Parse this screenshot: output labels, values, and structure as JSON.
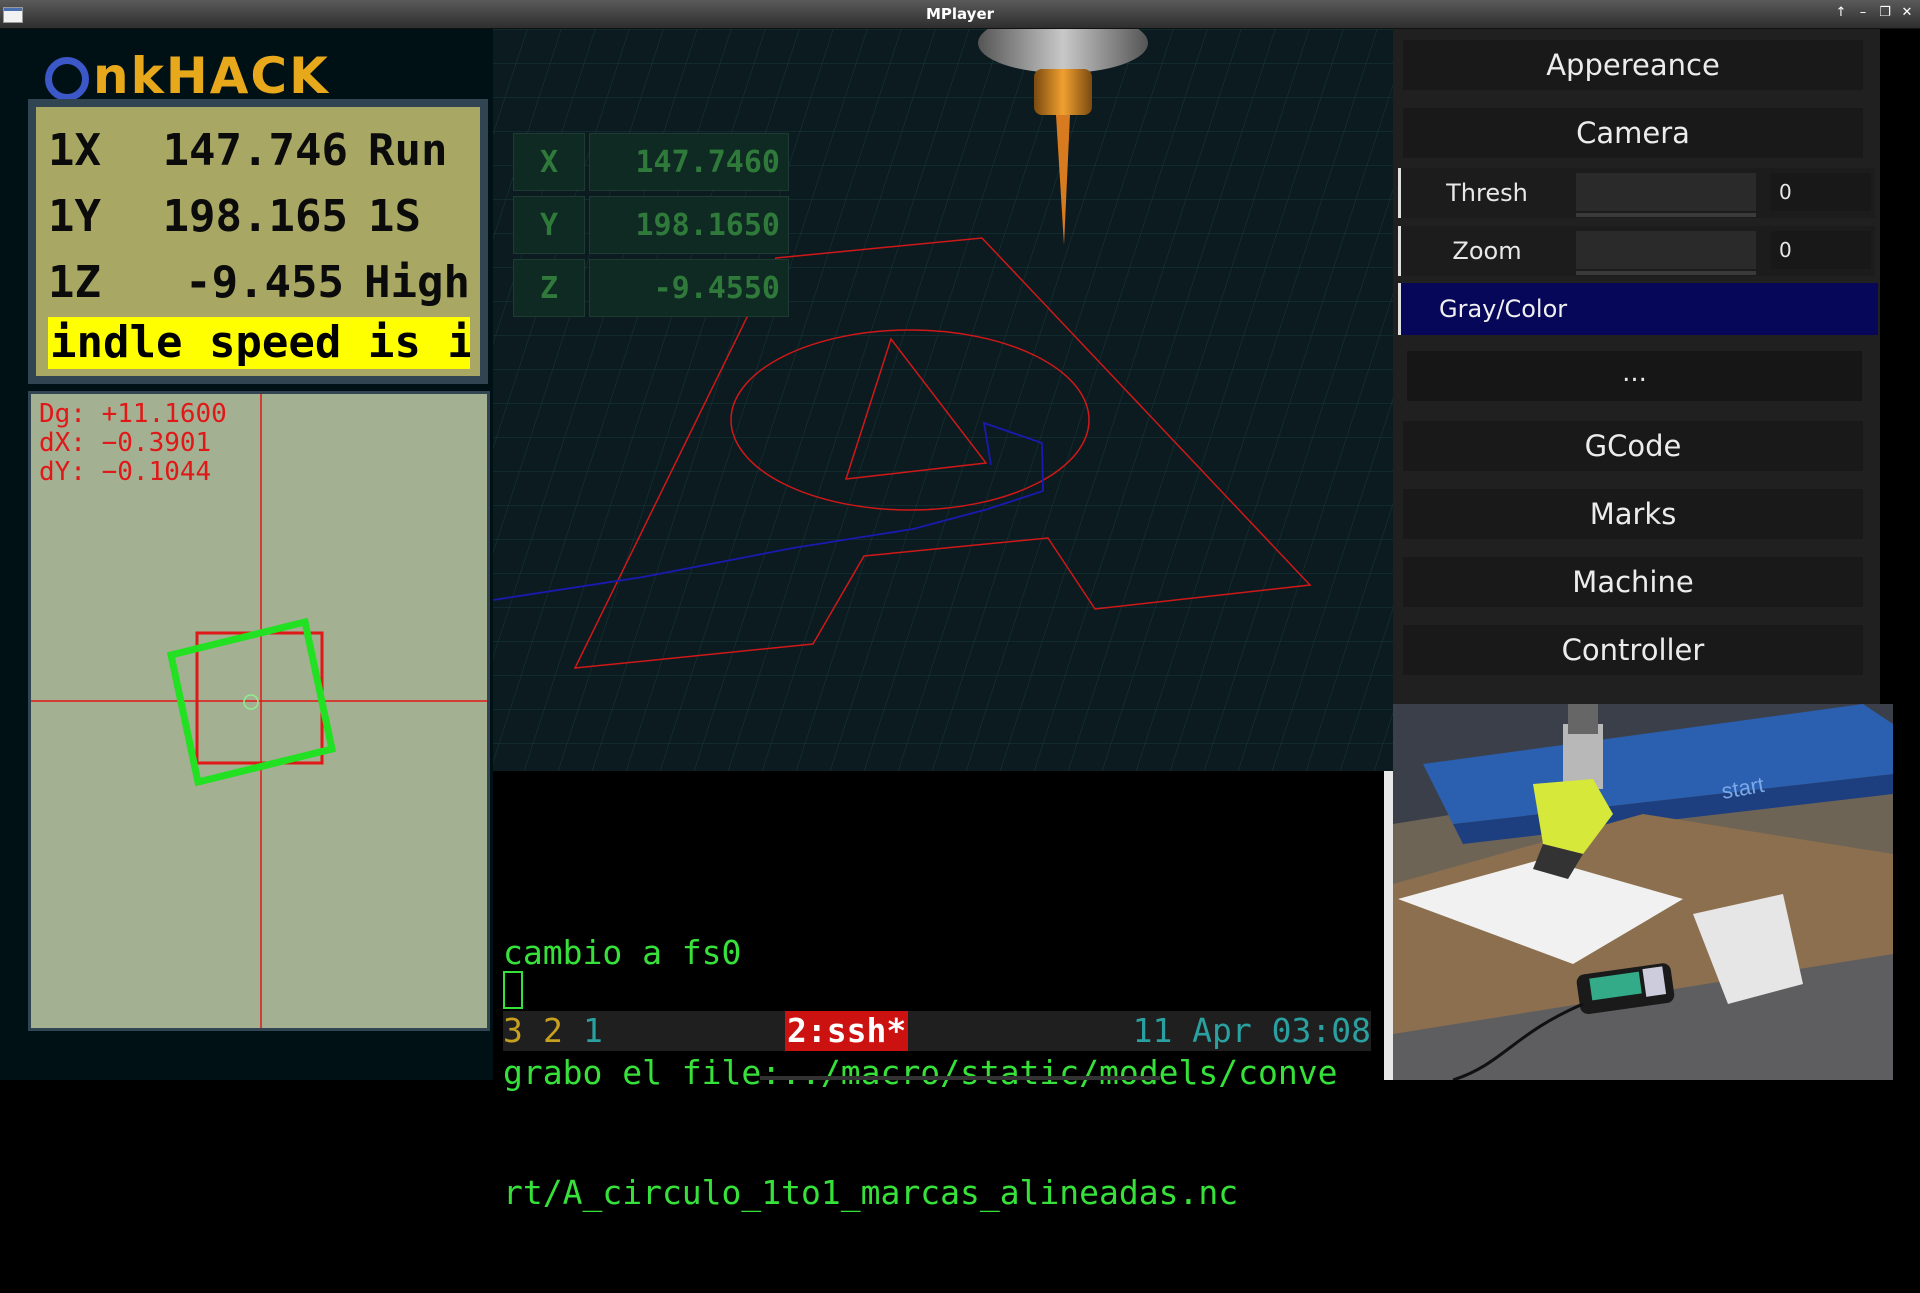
{
  "window": {
    "title": "MPlayer",
    "controls": [
      "↑",
      "–",
      "❐",
      "✕"
    ]
  },
  "logo": {
    "part1": "nk",
    "part2": "HACK"
  },
  "dro": {
    "rows": [
      {
        "axis": "1X",
        "value": "147.746",
        "state": "Run"
      },
      {
        "axis": "1Y",
        "value": "198.165",
        "state": "1S"
      },
      {
        "axis": "1Z",
        "value": "-9.455",
        "state": "High"
      }
    ],
    "message": "indle speed is i"
  },
  "camera_overlay": {
    "lines": [
      "Dg: +11.1600",
      "dX: −0.3901",
      "dY: −0.1044"
    ]
  },
  "viewport_coords": [
    {
      "axis": "X",
      "value": "147.7460"
    },
    {
      "axis": "Y",
      "value": "198.1650"
    },
    {
      "axis": "Z",
      "value": "-9.4550"
    }
  ],
  "terminal": {
    "lines": [
      "cambio a fs0",
      "grabo el file:../macro/static/models/conve",
      "rt/A_circulo_1to1_marcas_alineadas.nc"
    ],
    "status": {
      "w3": "3",
      "w2": "2",
      "w1": "1",
      "active": "2:ssh*",
      "clock": "11 Apr 03:08"
    }
  },
  "panel": {
    "appearance": "Appereance",
    "camera": "Camera",
    "thresh": {
      "label": "Thresh",
      "value": "0"
    },
    "zoom": {
      "label": "Zoom",
      "value": "0"
    },
    "gray_color": "Gray/Color",
    "more": "...",
    "gcode": "GCode",
    "marks": "Marks",
    "machine": "Machine",
    "controller": "Controller"
  },
  "colors": {
    "dro_bg": "#a8a864",
    "message_bg": "#ffff00",
    "terminal_text": "#36e23a",
    "toolpath": "#d01818",
    "probe_path": "#1a1ab0",
    "selected_item": "#07075a"
  }
}
